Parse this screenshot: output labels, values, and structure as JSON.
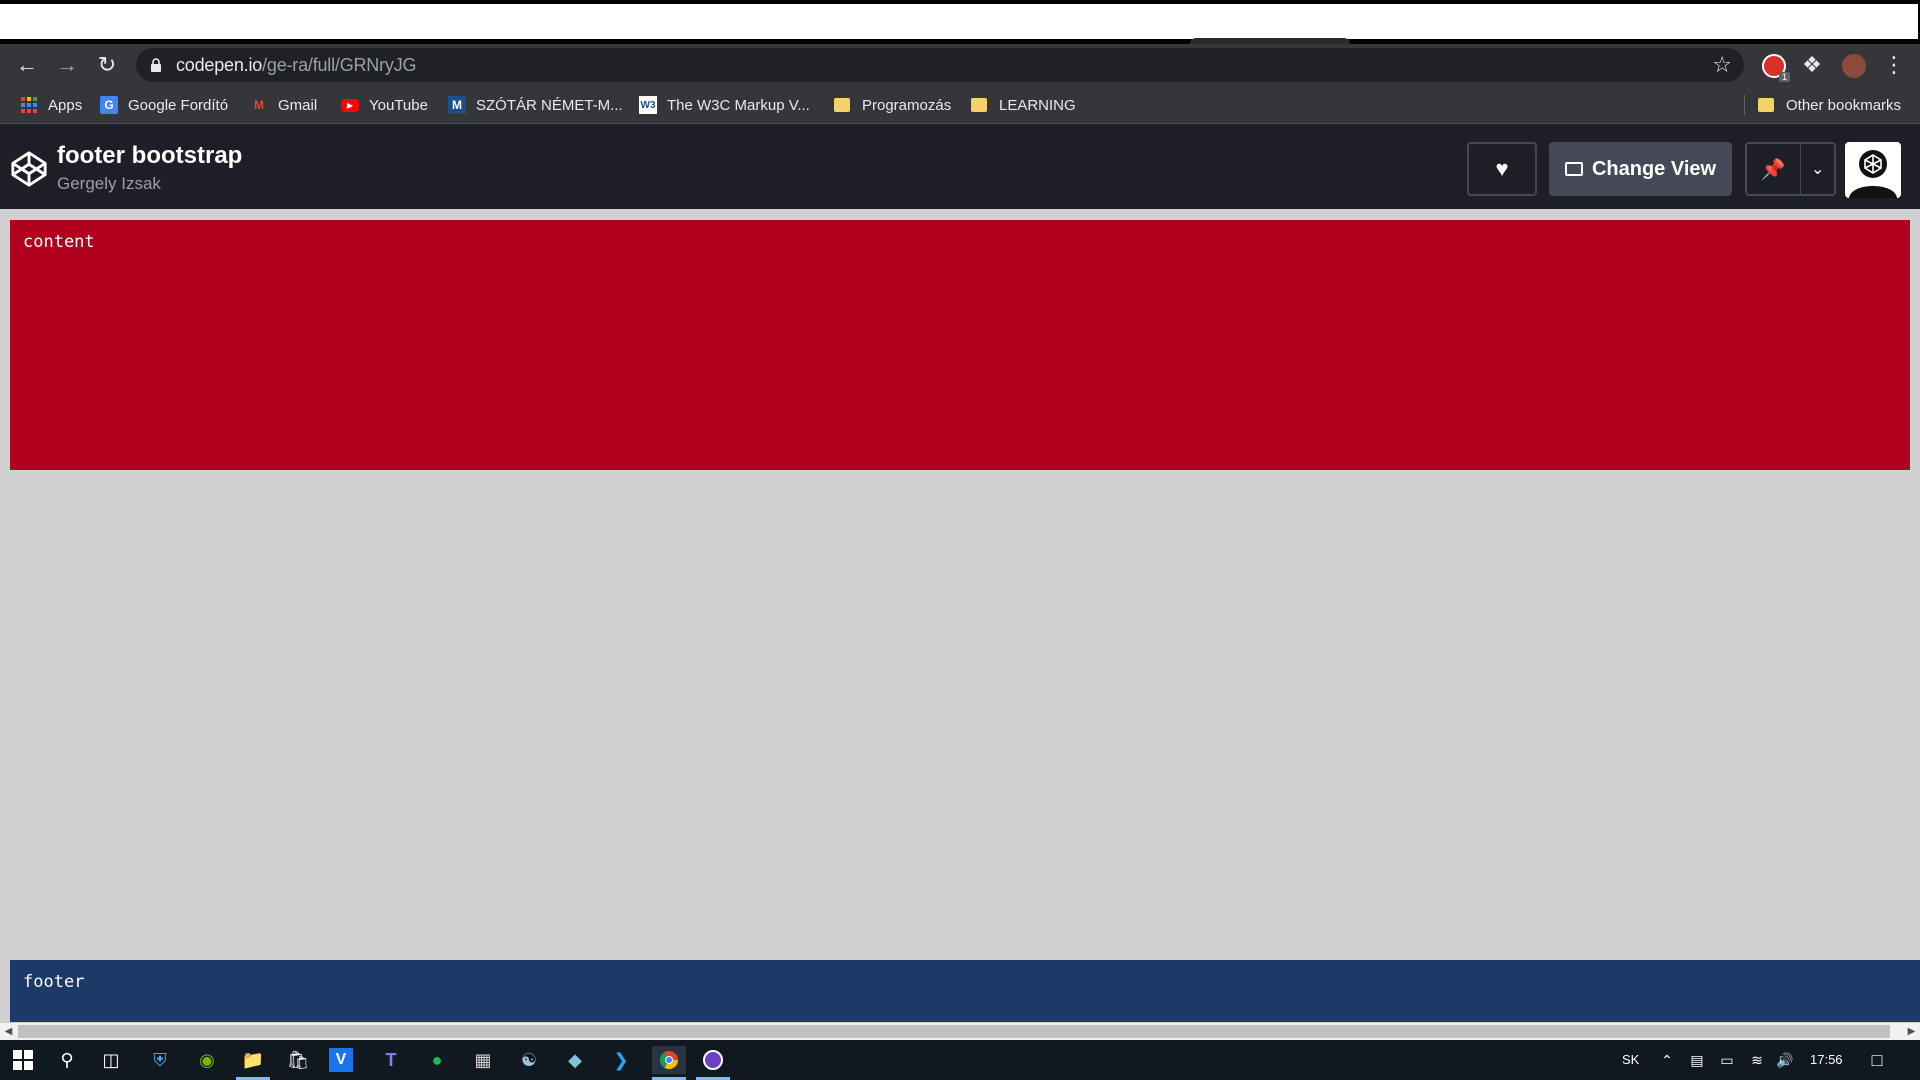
{
  "browser": {
    "url_host": "codepen.io",
    "url_path": "/ge-ra/full/GRNryJG",
    "bookmarks": [
      {
        "label": "Apps",
        "icon": "apps-grid-icon"
      },
      {
        "label": "Google Fordító",
        "icon": "google-translate-icon"
      },
      {
        "label": "Gmail",
        "icon": "gmail-icon"
      },
      {
        "label": "YouTube",
        "icon": "youtube-icon"
      },
      {
        "label": "SZÓTÁR NÉMET-M...",
        "icon": "dictionary-icon"
      },
      {
        "label": "The W3C Markup V...",
        "icon": "w3c-icon"
      },
      {
        "label": "Programozás",
        "icon": "folder-icon"
      },
      {
        "label": "LEARNING",
        "icon": "folder-icon"
      }
    ],
    "other_bookmarks": "Other bookmarks",
    "extension_badge": "1"
  },
  "codepen": {
    "title": "footer bootstrap",
    "author": "Gergely Izsak",
    "change_view_label": "Change View"
  },
  "page": {
    "content_text": "content",
    "footer_text": "footer"
  },
  "taskbar": {
    "language": "SK",
    "time": "17:56"
  },
  "colors": {
    "content_bg": "#b0001e",
    "footer_bg": "#1c3968",
    "page_bg": "#d0d0d0",
    "codepen_header_bg": "#1e1f26"
  }
}
